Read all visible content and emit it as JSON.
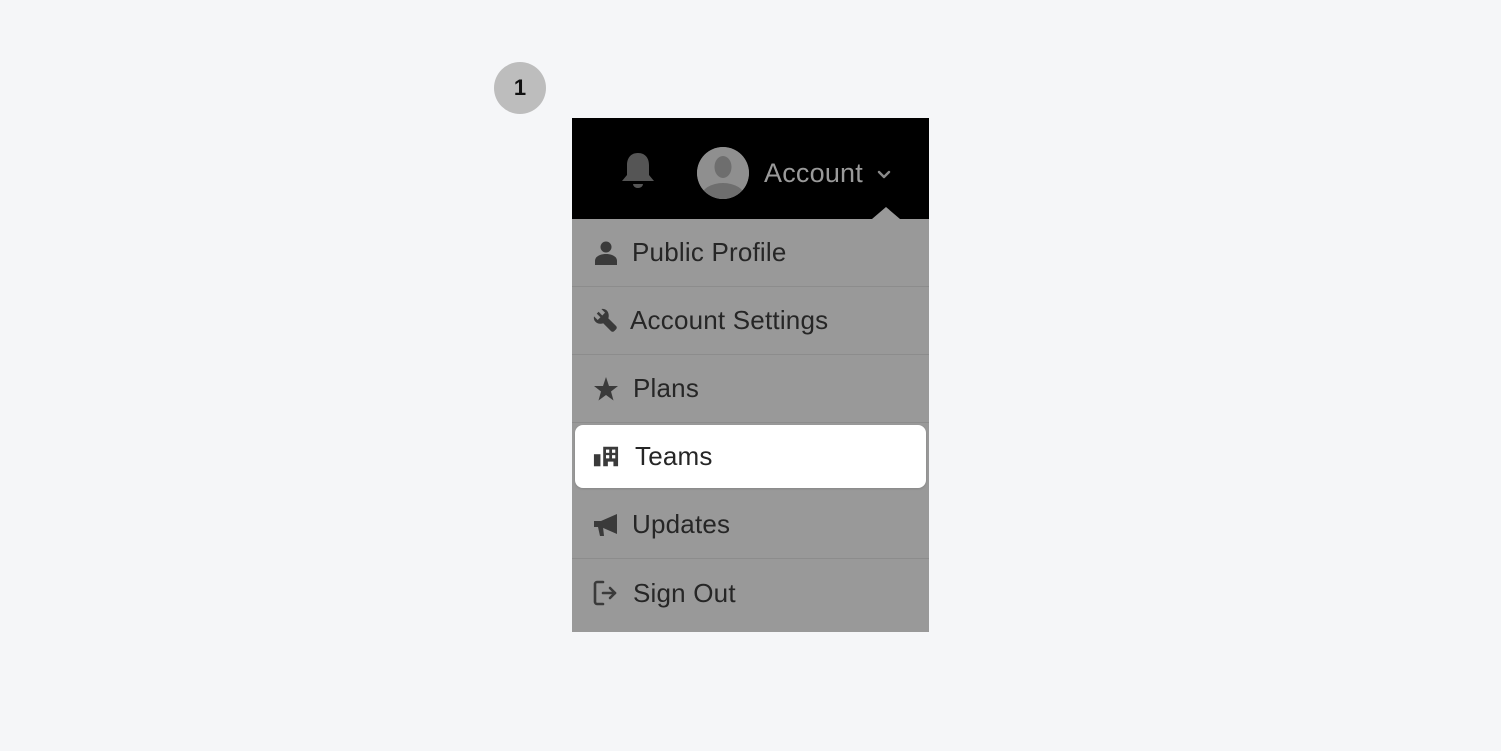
{
  "step": {
    "number": "1"
  },
  "header": {
    "notification_icon": "bell-icon",
    "avatar_icon": "user-avatar-icon",
    "account_label": "Account",
    "dropdown_icon": "chevron-down-icon"
  },
  "menu": {
    "items": [
      {
        "label": "Public Profile",
        "icon": "person-icon",
        "active": false
      },
      {
        "label": "Account Settings",
        "icon": "wrench-icon",
        "active": false
      },
      {
        "label": "Plans",
        "icon": "star-icon",
        "active": false
      },
      {
        "label": "Teams",
        "icon": "building-icon",
        "active": true
      },
      {
        "label": "Updates",
        "icon": "megaphone-icon",
        "active": false
      },
      {
        "label": "Sign Out",
        "icon": "sign-out-icon",
        "active": false
      }
    ]
  },
  "colors": {
    "page_background": "#f5f6f8",
    "header_background": "#000000",
    "menu_background": "#999999",
    "highlight_background": "#ffffff",
    "badge_background": "#bdbdbd",
    "text": "#262626"
  }
}
